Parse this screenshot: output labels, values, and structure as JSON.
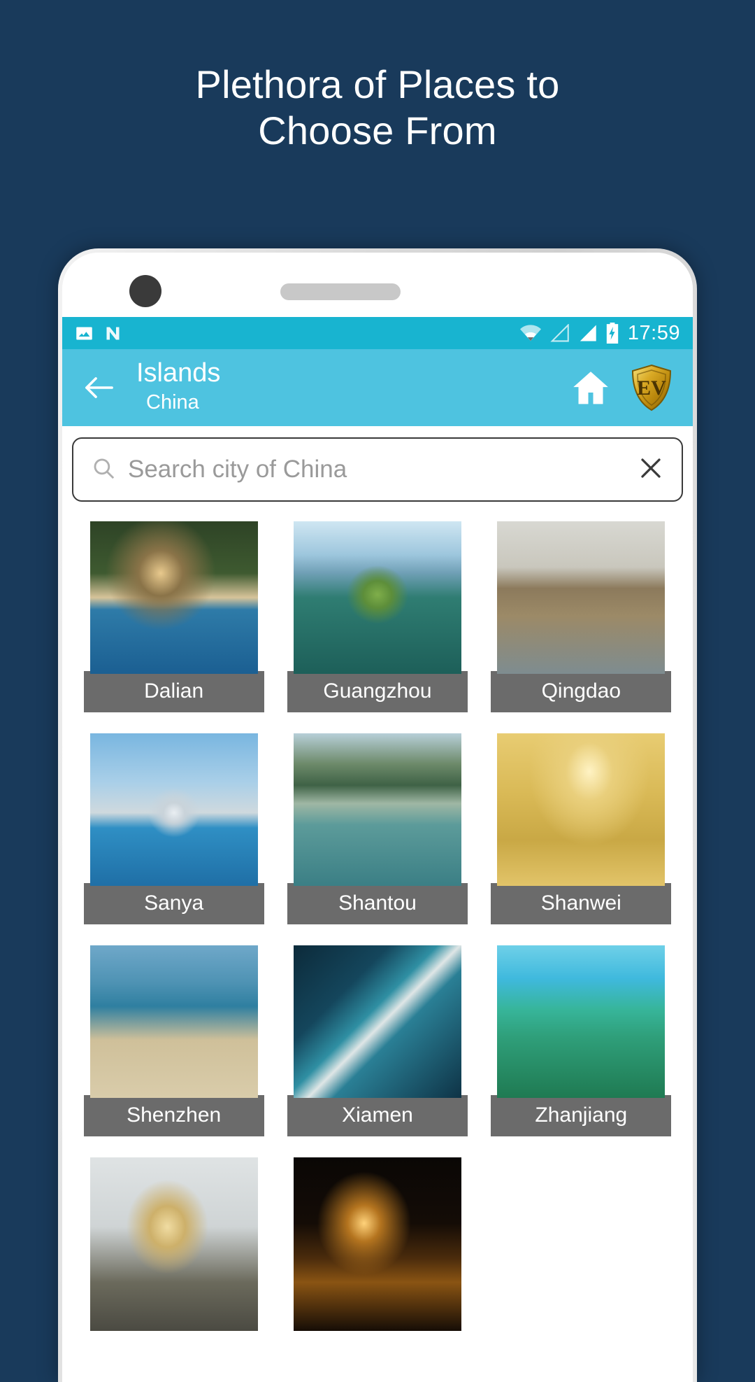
{
  "headline": {
    "line1": "Plethora of Places to",
    "line2": "Choose From"
  },
  "colors": {
    "background": "#193a5b",
    "statusbar": "#18b4d0",
    "toolbar": "#4ec3e0",
    "caption": "#6b6b6b",
    "logo_gold": "#d4a017"
  },
  "statusbar": {
    "time": "17:59",
    "left_icons": [
      "image-icon",
      "android-nougat-icon"
    ],
    "right_icons": [
      "wifi-icon",
      "signal-empty-icon",
      "signal-full-icon",
      "battery-charging-icon"
    ]
  },
  "toolbar": {
    "back_icon": "arrow-left-icon",
    "title": "Islands",
    "subtitle": "China",
    "home_icon": "home-icon",
    "logo_text": "EV",
    "logo_icon": "ev-shield-logo"
  },
  "search": {
    "placeholder": "Search city of China",
    "value": "",
    "search_icon": "search-icon",
    "clear_icon": "close-icon"
  },
  "grid": {
    "items": [
      {
        "label": "Dalian",
        "art": "th-dalian"
      },
      {
        "label": "Guangzhou",
        "art": "th-guangzhou"
      },
      {
        "label": "Qingdao",
        "art": "th-qingdao"
      },
      {
        "label": "Sanya",
        "art": "th-sanya"
      },
      {
        "label": "Shantou",
        "art": "th-shantou"
      },
      {
        "label": "Shanwei",
        "art": "th-shanwei"
      },
      {
        "label": "Shenzhen",
        "art": "th-shenzhen"
      },
      {
        "label": "Xiamen",
        "art": "th-xiamen"
      },
      {
        "label": "Zhanjiang",
        "art": "th-zhanjiang"
      },
      {
        "label": "",
        "art": "th-bottom1"
      },
      {
        "label": "",
        "art": "th-bottom2"
      }
    ]
  }
}
